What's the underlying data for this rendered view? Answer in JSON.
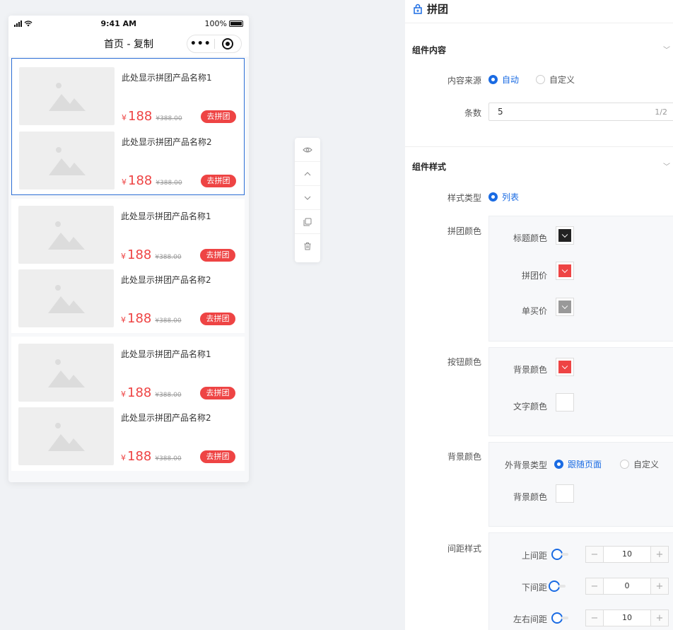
{
  "phone": {
    "status": {
      "time": "9:41 AM",
      "battery": "100%"
    },
    "nav_title": "首页 - 复制",
    "capsule_dots": "•••",
    "blocks": [
      {
        "selected": true,
        "products": [
          {
            "name": "此处显示拼团产品名称1",
            "yen": "¥",
            "price": "188",
            "old_price": "¥388.00",
            "button": "去拼团"
          },
          {
            "name": "此处显示拼团产品名称2",
            "yen": "¥",
            "price": "188",
            "old_price": "¥388.00",
            "button": "去拼团"
          }
        ]
      },
      {
        "selected": false,
        "products": [
          {
            "name": "此处显示拼团产品名称1",
            "yen": "¥",
            "price": "188",
            "old_price": "¥388.00",
            "button": "去拼团"
          },
          {
            "name": "此处显示拼团产品名称2",
            "yen": "¥",
            "price": "188",
            "old_price": "¥388.00",
            "button": "去拼团"
          }
        ]
      },
      {
        "selected": false,
        "products": [
          {
            "name": "此处显示拼团产品名称1",
            "yen": "¥",
            "price": "188",
            "old_price": "¥388.00",
            "button": "去拼团"
          },
          {
            "name": "此处显示拼团产品名称2",
            "yen": "¥",
            "price": "188",
            "old_price": "¥388.00",
            "button": "去拼团"
          }
        ]
      }
    ]
  },
  "toolbar": {
    "icons": [
      "eye-icon",
      "chevron-up-icon",
      "chevron-down-icon",
      "copy-icon",
      "trash-icon"
    ]
  },
  "panel": {
    "title": "拼团",
    "content_section": {
      "title": "组件内容",
      "source_label": "内容来源",
      "source_options": [
        "自动",
        "自定义"
      ],
      "source_selected": "自动",
      "count_label": "条数",
      "count_value": "5",
      "count_counter": "1/2"
    },
    "style_section": {
      "title": "组件样式",
      "style_type_label": "样式类型",
      "style_type_option": "列表",
      "group_color": {
        "label": "拼团颜色",
        "items": [
          {
            "label": "标题颜色",
            "color": "#222222"
          },
          {
            "label": "拼团价",
            "color": "#ee4444"
          },
          {
            "label": "单买价",
            "color": "#999999"
          }
        ]
      },
      "button_color": {
        "label": "按钮颜色",
        "items": [
          {
            "label": "背景颜色",
            "color": "#ee4444"
          },
          {
            "label": "文字颜色",
            "color": "#ffffff"
          }
        ]
      },
      "bg_color": {
        "label": "背景颜色",
        "outer_type_label": "外背景类型",
        "outer_options": [
          "跟随页面",
          "自定义"
        ],
        "outer_selected": "跟随页面",
        "bg_label": "背景颜色",
        "bg_color": "#ffffff"
      },
      "spacing": {
        "label": "间距样式",
        "items": [
          {
            "label": "上间距",
            "value": "10"
          },
          {
            "label": "下间距",
            "value": "0"
          },
          {
            "label": "左右间距",
            "value": "10"
          }
        ]
      }
    }
  },
  "colors": {
    "accent": "#1a6be3",
    "price": "#ee4444",
    "selected_border": "#2d6fd6"
  }
}
